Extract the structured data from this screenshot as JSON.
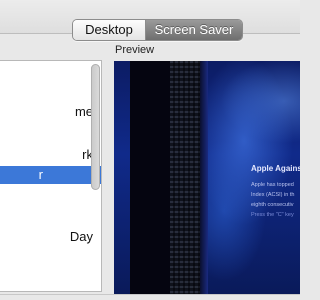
{
  "tabs": {
    "desktop": "Desktop",
    "screen_saver": "Screen Saver",
    "selected": "Screen Saver"
  },
  "preview_label": "Preview",
  "list": {
    "items": [
      {
        "label": "me",
        "selected": false
      },
      {
        "label": "rk",
        "selected": false
      },
      {
        "label": "r",
        "selected": true
      },
      {
        "label": "Day",
        "selected": false
      }
    ]
  },
  "preview": {
    "news_title": "Apple Agains",
    "news_lines": [
      "Apple has topped",
      "Index (ACSI) in th",
      "eighth consecutiv",
      "Press the \"C\" key"
    ]
  },
  "colors": {
    "selection": "#3c78d8",
    "preview_bg": "#102a8a"
  }
}
